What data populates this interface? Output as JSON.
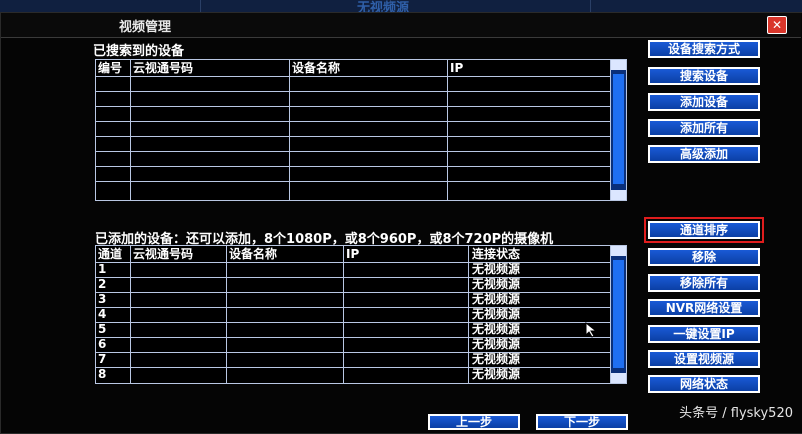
{
  "background": {
    "strip_text": [
      "无视频源"
    ]
  },
  "window": {
    "title": "视频管理",
    "close_glyph": "✕"
  },
  "searched": {
    "label": "已搜索到的设备",
    "headers": [
      "编号",
      "云视通号码",
      "设备名称",
      "IP"
    ]
  },
  "added": {
    "label": "已添加的设备：还可以添加，8个1080P，或8个960P，或8个720P的摄像机",
    "headers": [
      "通道",
      "云视通号码",
      "设备名称",
      "IP",
      "连接状态"
    ],
    "rows": [
      {
        "ch": "1",
        "status": "无视频源"
      },
      {
        "ch": "2",
        "status": "无视频源"
      },
      {
        "ch": "3",
        "status": "无视频源"
      },
      {
        "ch": "4",
        "status": "无视频源"
      },
      {
        "ch": "5",
        "status": "无视频源"
      },
      {
        "ch": "6",
        "status": "无视频源"
      },
      {
        "ch": "7",
        "status": "无视频源"
      },
      {
        "ch": "8",
        "status": "无视频源"
      }
    ]
  },
  "side_buttons": {
    "search_mode": "设备搜索方式",
    "search": "搜索设备",
    "add": "添加设备",
    "add_all": "添加所有",
    "advanced_add": "高级添加",
    "channel_sort": "通道排序",
    "remove": "移除",
    "remove_all": "移除所有",
    "nvr_network": "NVR网络设置",
    "one_key_ip": "一键设置IP",
    "set_video_source": "设置视频源",
    "network_status": "网络状态"
  },
  "bottom_buttons": {
    "prev": "上一步",
    "next": "下一步"
  },
  "watermark": "头条号 / flysky520",
  "colors": {
    "button": "#1a5ad6",
    "highlight": "#e01d1d",
    "close": "#d9362b"
  }
}
